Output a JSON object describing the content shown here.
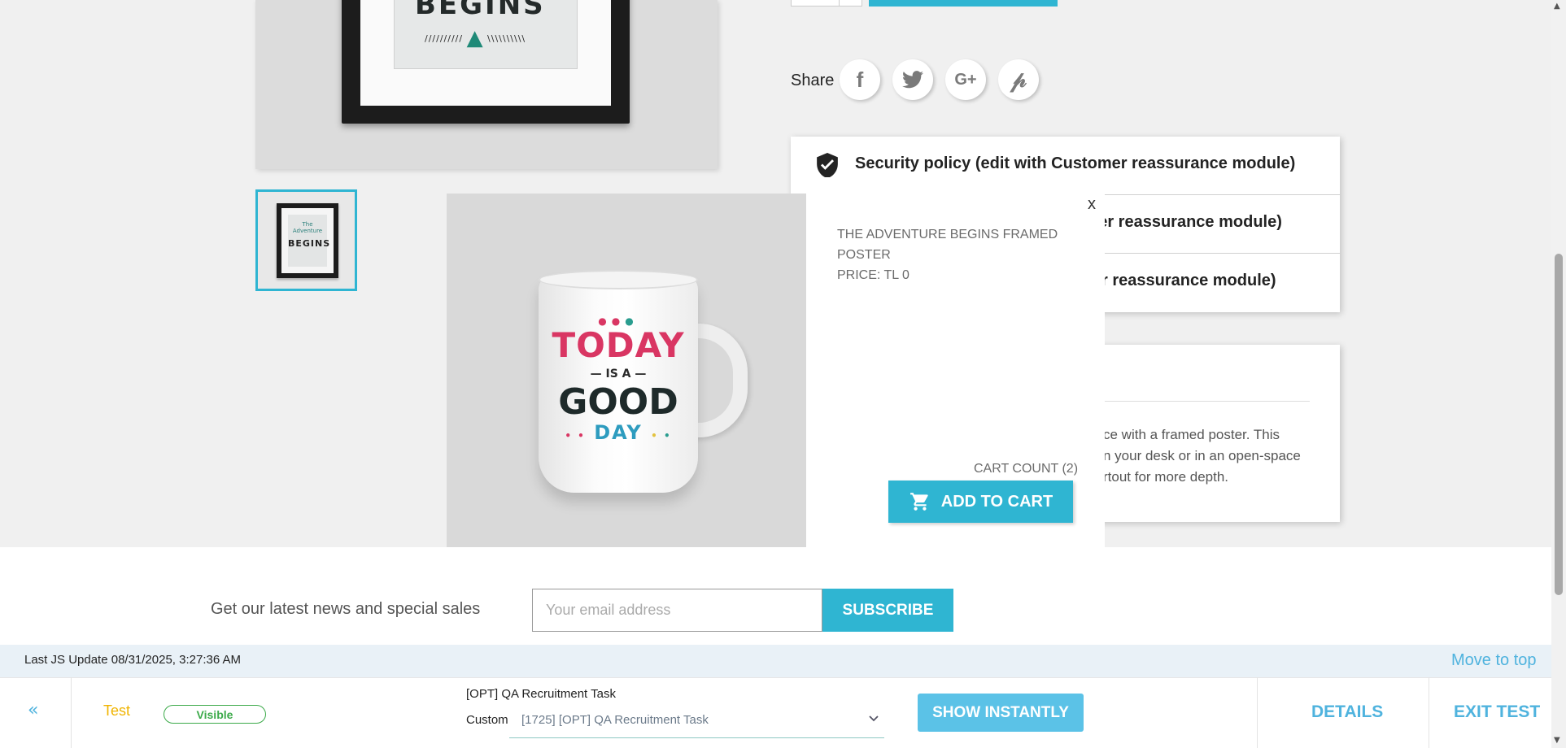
{
  "product": {
    "poster_word": "BEGINS",
    "thumb_small": "The Adventure",
    "thumb_big": "BEGINS"
  },
  "share": {
    "label": "Share",
    "icons": [
      "facebook-icon",
      "twitter-icon",
      "google-plus-icon",
      "pinterest-icon"
    ]
  },
  "reassurance": {
    "items": [
      "Security policy (edit with Customer reassurance module)",
      "Delivery policy (edit with Customer reassurance module)",
      "Return policy (edit with Customer reassurance module)"
    ],
    "visible_fragments": [
      "ner reassurance module)",
      "r reassurance module)"
    ]
  },
  "description": {
    "text_fragment": "ce with a framed poster. This\nn your desk or in an open-space\nrtout for more depth."
  },
  "modal": {
    "close": "x",
    "title_line1": "THE ADVENTURE BEGINS FRAMED",
    "title_line2": "POSTER",
    "price": "PRICE: TL 0",
    "cart_count": "CART COUNT (2)",
    "add_to_cart": "ADD TO CART",
    "mug": {
      "today": "TODAY",
      "is_a": "IS A",
      "good": "GOOD",
      "day": "DAY"
    }
  },
  "newsletter": {
    "text": "Get our latest news and special sales",
    "placeholder": "Your email address",
    "button": "SUBSCRIBE"
  },
  "test_panel": {
    "last_update": "Last JS Update 08/31/2025, 3:27:36 AM",
    "move_to_top": "Move to top",
    "back": "«",
    "test_label": "Test",
    "visible_badge": "Visible",
    "opt_title": "[OPT] QA Recruitment Task",
    "custom_label": "Custom",
    "selected_option": "[1725] [OPT] QA Recruitment Task",
    "show_instantly": "SHOW INSTANTLY",
    "details": "DETAILS",
    "exit_test": "EXIT TEST"
  },
  "colors": {
    "accent": "#2fb5d2",
    "link_blue": "#4fb3de",
    "visible_green": "#3caa4a",
    "test_yellow": "#f0b400"
  }
}
